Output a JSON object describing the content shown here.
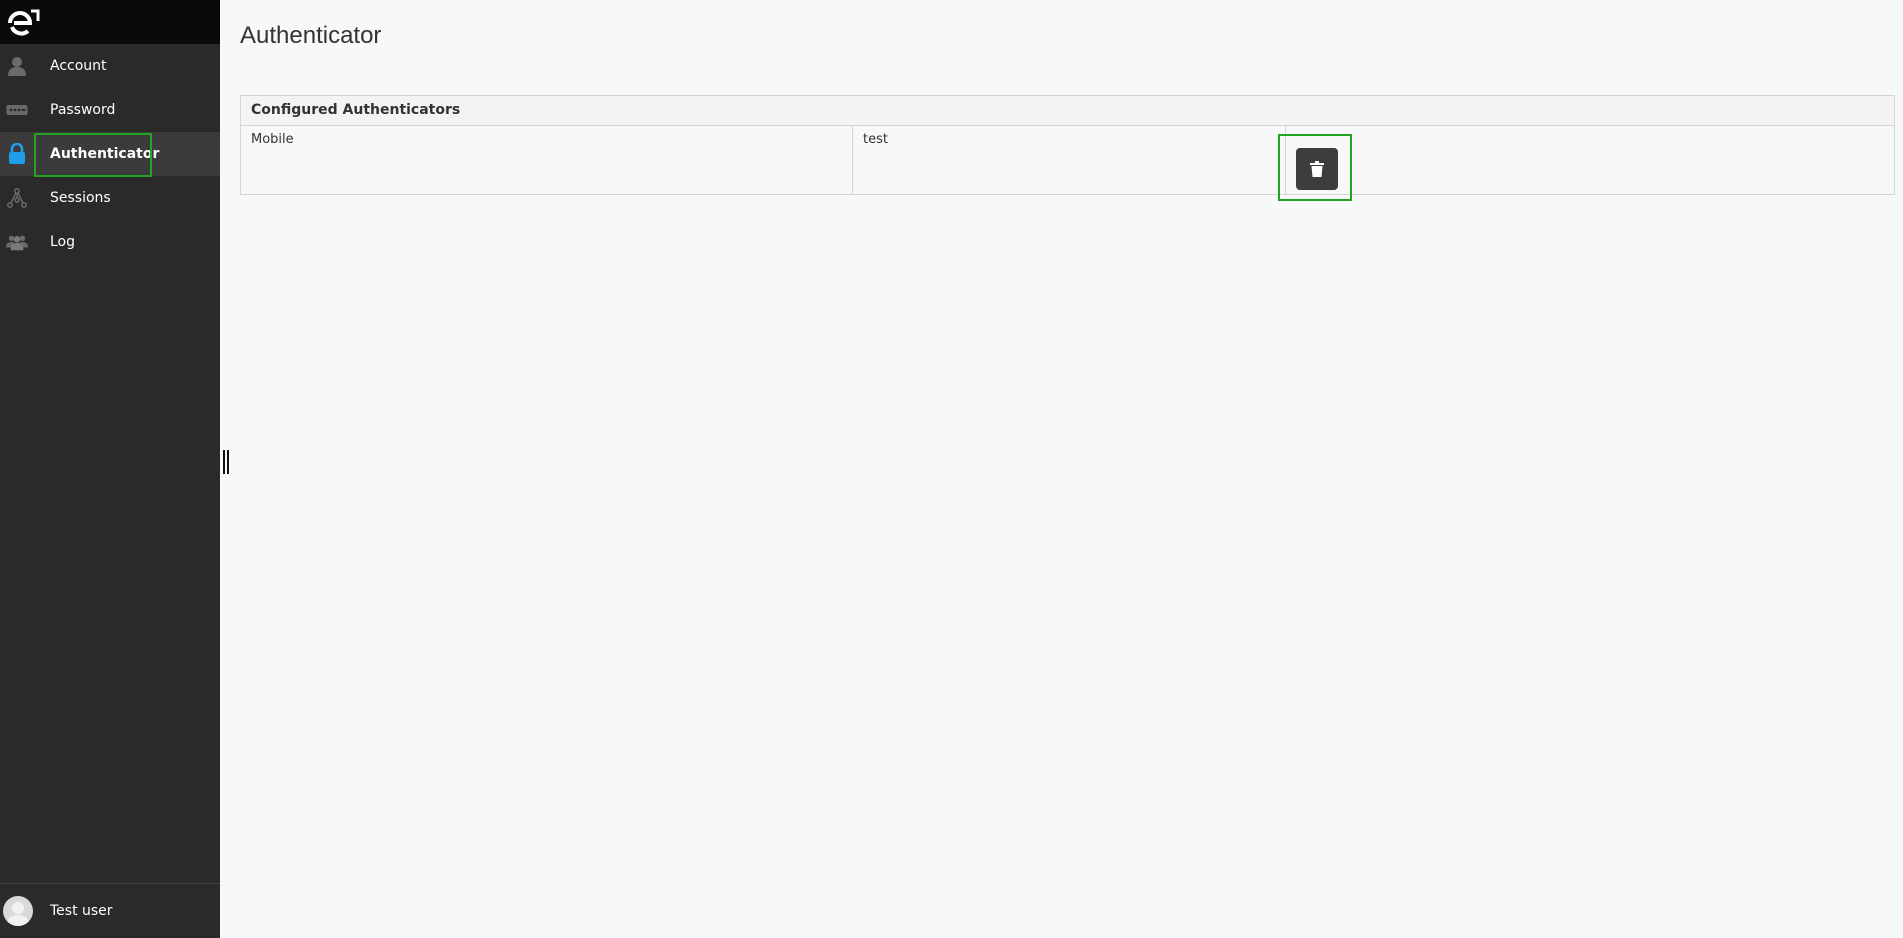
{
  "sidebar": {
    "items": [
      {
        "label": "Account",
        "icon": "user-icon"
      },
      {
        "label": "Password",
        "icon": "password-icon"
      },
      {
        "label": "Authenticator",
        "icon": "lock-icon",
        "active": true
      },
      {
        "label": "Sessions",
        "icon": "network-icon"
      },
      {
        "label": "Log",
        "icon": "users-icon"
      }
    ],
    "user": {
      "name": "Test user"
    }
  },
  "main": {
    "title": "Authenticator",
    "table": {
      "header": "Configured Authenticators",
      "rows": [
        {
          "type": "Mobile",
          "name": "test",
          "action": "delete"
        }
      ]
    }
  },
  "colors": {
    "sidebar_bg": "#2a2a2a",
    "brand_bg": "#0a0a0a",
    "active_icon": "#1e9ee8",
    "highlight": "#22a322",
    "button_bg": "#3d3d3d"
  }
}
